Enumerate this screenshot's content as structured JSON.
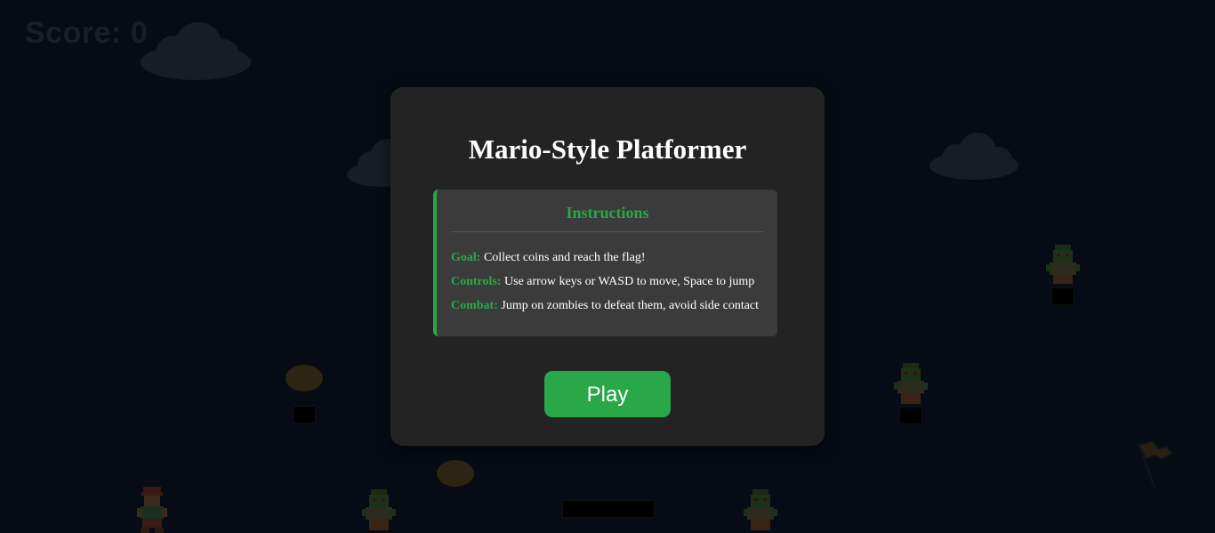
{
  "hud": {
    "score_label": "Score: 0"
  },
  "menu": {
    "title": "Mario-Style Platformer",
    "instructions_heading": "Instructions",
    "instructions": [
      {
        "key": "Goal:",
        "text": "Collect coins and reach the flag!"
      },
      {
        "key": "Controls:",
        "text": "Use arrow keys or WASD to move, Space to jump"
      },
      {
        "key": "Combat:",
        "text": "Jump on zombies to defeat them, avoid side contact"
      }
    ],
    "play_label": "Play"
  },
  "colors": {
    "background": "#070b15",
    "panel": "#232323",
    "instructions_box": "#3b3b3b",
    "accent_green": "#29a847",
    "text": "#ffffff"
  },
  "icons": [
    "cloud",
    "coin",
    "block",
    "player-sprite",
    "zombie-sprite",
    "goal-flag"
  ]
}
